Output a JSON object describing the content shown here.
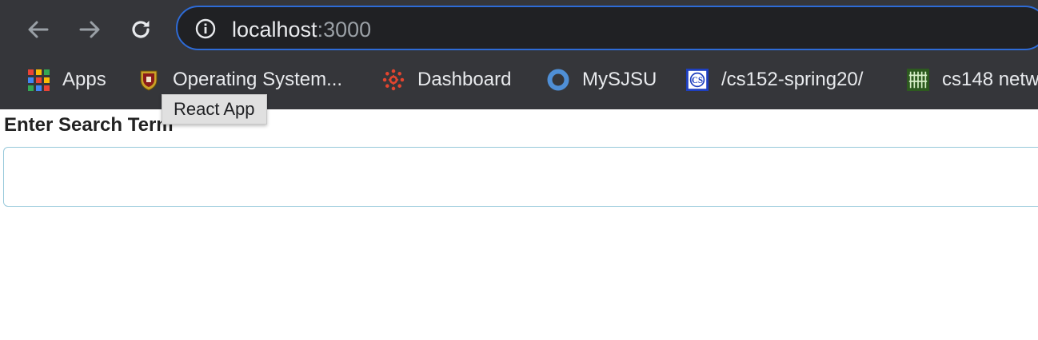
{
  "browser": {
    "address_bar": {
      "host": "localhost",
      "port": ":3000"
    },
    "bookmarks": [
      {
        "label": "Apps",
        "icon": "apps-grid-icon"
      },
      {
        "label": "Operating System...",
        "icon": "university-crest-icon"
      },
      {
        "label": "Dashboard",
        "icon": "canvas-logo-icon"
      },
      {
        "label": "MySJSU",
        "icon": "ring-icon"
      },
      {
        "label": "/cs152-spring20/",
        "icon": "cs-logo-icon"
      },
      {
        "label": "cs148 netw",
        "icon": "grid-logo-icon"
      }
    ],
    "tooltip": "React App"
  },
  "page": {
    "search_label": "Enter Search Term",
    "search_value": ""
  },
  "colors": {
    "chrome_bg": "#35363a",
    "omnibox_bg": "#202124",
    "omnibox_border": "#2e6bd6",
    "input_border": "#96c8da"
  }
}
